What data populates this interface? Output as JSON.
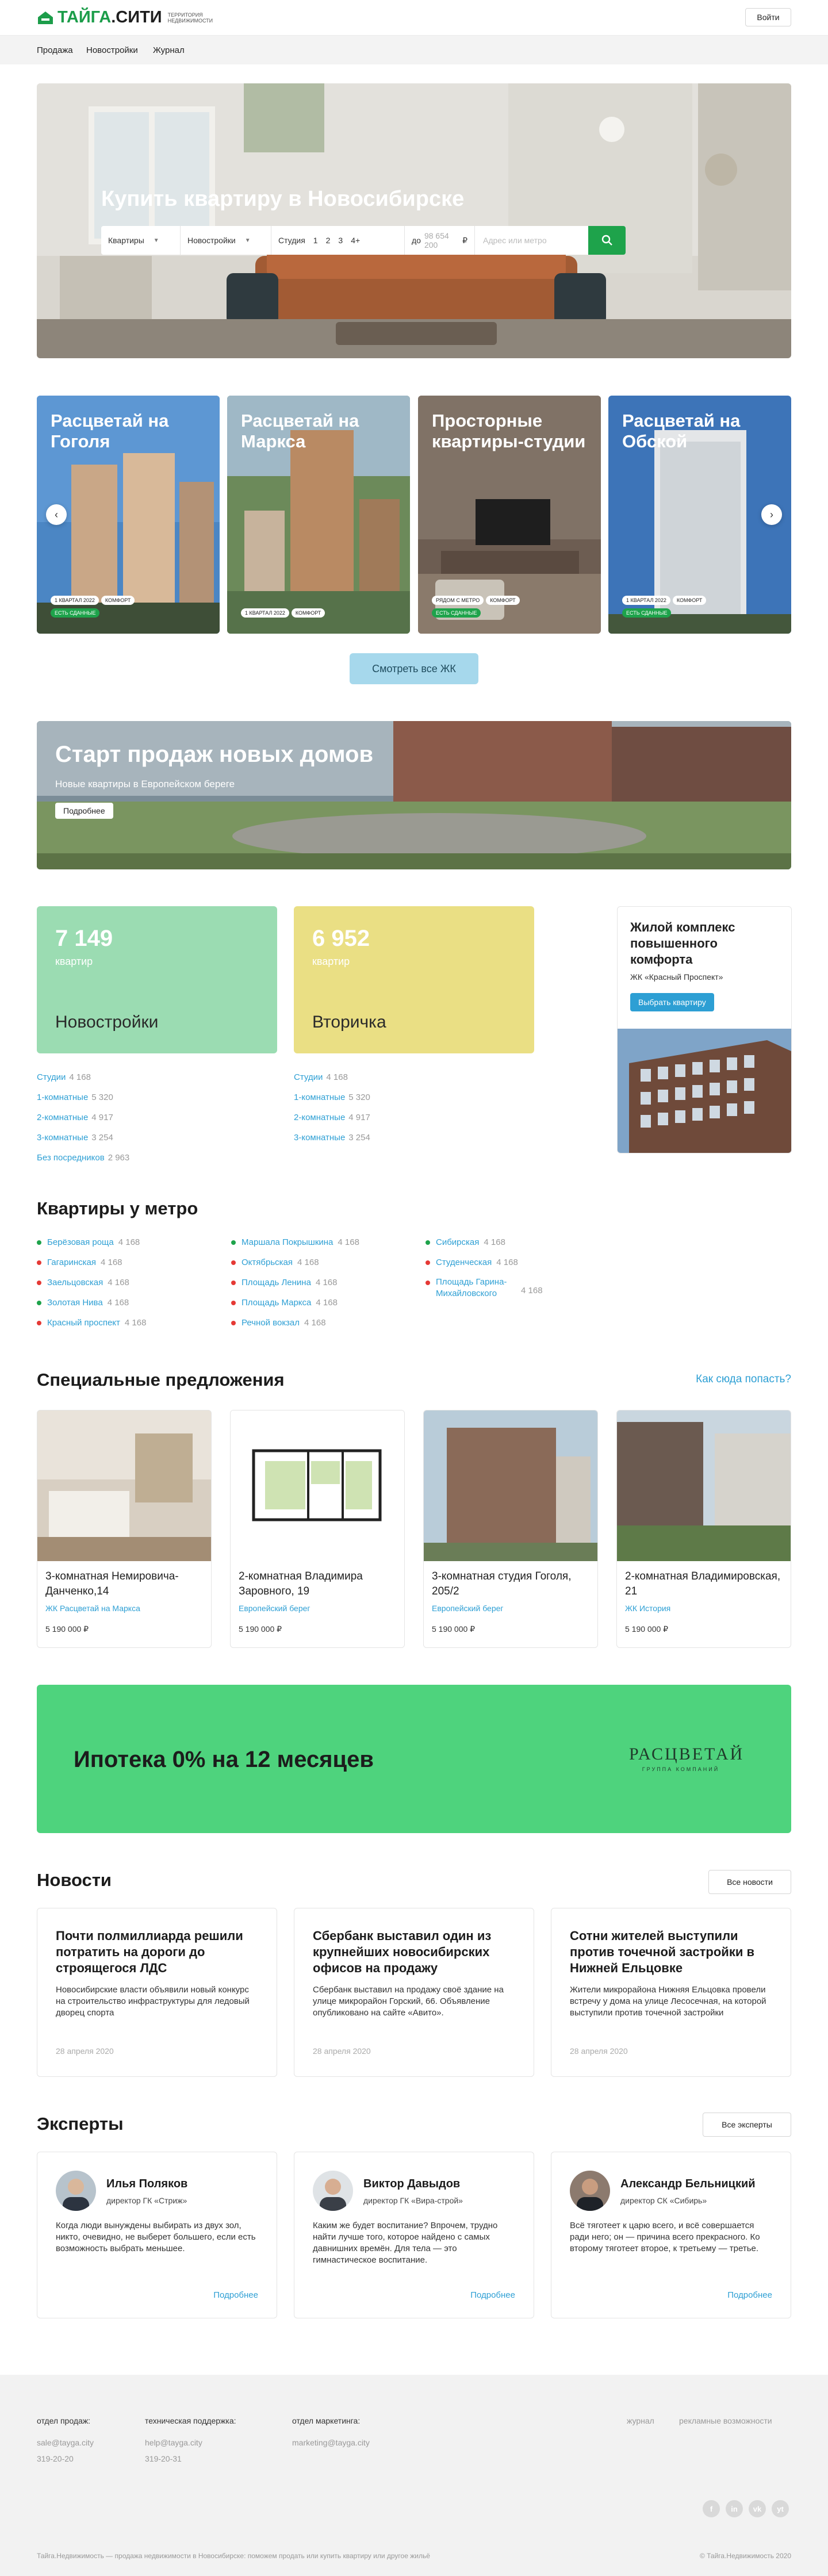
{
  "header": {
    "logo_main": "ТАЙГА",
    "logo_dot": ".СИТИ",
    "logo_sub_1": "Территория",
    "logo_sub_2": "недвижимости",
    "login": "Войти"
  },
  "nav": [
    "Продажа",
    "Новостройки",
    "Журнал"
  ],
  "hero": {
    "title": "Купить квартиру в Новосибирске",
    "search": {
      "type": "Квартиры",
      "market": "Новостройки",
      "rooms": [
        "Студия",
        "1",
        "2",
        "3",
        "4+"
      ],
      "price_prefix": "до",
      "price_value": "98 654 200",
      "price_unit": "₽",
      "address_placeholder": "Адрес или метро"
    }
  },
  "complexes": [
    {
      "title": "Расцветай на Гоголя",
      "tags": [
        "1 КВАРТАЛ 2022",
        "КОМФОРТ",
        "ЕСТЬ СДАННЫЕ"
      ]
    },
    {
      "title": "Расцветай на Маркса",
      "tags": [
        "1 КВАРТАЛ 2022",
        "КОМФОРТ"
      ]
    },
    {
      "title": "Просторные квартиры-студии",
      "tags": [
        "РЯДОМ С МЕТРО",
        "КОМФОРТ",
        "ЕСТЬ СДАННЫЕ"
      ]
    },
    {
      "title": "Расцветай на Обской",
      "tags": [
        "1 КВАРТАЛ 2022",
        "КОМФОРТ",
        "ЕСТЬ СДАННЫЕ"
      ]
    }
  ],
  "see_all": "Смотреть все ЖК",
  "banner": {
    "title": "Старт продаж новых домов",
    "subtitle": "Новые квартиры в Европейском береге",
    "button": "Подробнее"
  },
  "stats": [
    {
      "number": "7 149",
      "unit": "квартир",
      "title": "Новостройки",
      "color": "#9bdcb2",
      "links": [
        [
          "Студии",
          "4 168"
        ],
        [
          "1-комнатные",
          "5 320"
        ],
        [
          "2-комнатные",
          "4 917"
        ],
        [
          "3-комнатные",
          "3 254"
        ],
        [
          "Без посредников",
          "2 963"
        ]
      ]
    },
    {
      "number": "6 952",
      "unit": "квартир",
      "title": "Вторичка",
      "color": "#eadf84",
      "links": [
        [
          "Студии",
          "4 168"
        ],
        [
          "1-комнатные",
          "5 320"
        ],
        [
          "2-комнатные",
          "4 917"
        ],
        [
          "3-комнатные",
          "3 254"
        ]
      ]
    }
  ],
  "promo": {
    "title": "Жилой комплекс повышенного комфорта",
    "complex": "ЖК «Красный Проспект»",
    "button": "Выбрать квартиру"
  },
  "metro": {
    "title": "Квартиры у метро",
    "columns": [
      [
        [
          "Берёзовая роща",
          "4 168",
          "#1ea34b"
        ],
        [
          "Гагаринская",
          "4 168",
          "#e53935"
        ],
        [
          "Заельцовская",
          "4 168",
          "#e53935"
        ],
        [
          "Золотая Нива",
          "4 168",
          "#1ea34b"
        ],
        [
          "Красный проспект",
          "4 168",
          "#e53935"
        ]
      ],
      [
        [
          "Маршала Покрышкина",
          "4 168",
          "#1ea34b"
        ],
        [
          "Октябрьская",
          "4 168",
          "#e53935"
        ],
        [
          "Площадь Ленина",
          "4 168",
          "#e53935"
        ],
        [
          "Площадь Маркса",
          "4 168",
          "#e53935"
        ],
        [
          "Речной вокзал",
          "4 168",
          "#e53935"
        ]
      ],
      [
        [
          "Сибирская",
          "4 168",
          "#1ea34b"
        ],
        [
          "Студенческая",
          "4 168",
          "#e53935"
        ],
        [
          "Площадь Гарина-Михайловского",
          "4 168",
          "#e53935"
        ]
      ]
    ]
  },
  "offers": {
    "title": "Специальные предложения",
    "link": "Как сюда попасть?",
    "items": [
      {
        "title": "3-комнатная Немировича-Данченко,14",
        "complex": "ЖК Расцветай на Маркса",
        "price": "5 190 000 ₽"
      },
      {
        "title": "2-комнатная Владимира Заровного, 19",
        "complex": "Европейский берег",
        "price": "5 190 000 ₽"
      },
      {
        "title": "3-комнатная студия Гоголя, 205/2",
        "complex": "Европейский берег",
        "price": "5 190 000 ₽"
      },
      {
        "title": "2-комнатная Владимировская, 21",
        "complex": "ЖК История",
        "price": "5 190 000 ₽"
      }
    ]
  },
  "mortgage": {
    "text": "Ипотека 0% на 12 месяцев",
    "brand": "РАСЦВЕТАЙ",
    "brand_sub": "ГРУППА КОМПАНИЙ"
  },
  "news": {
    "title": "Новости",
    "all": "Все новости",
    "items": [
      {
        "title": "Почти полмиллиарда решили потратить на дороги до строящегося ЛДС",
        "text": "Новосибирские власти объявили новый конкурс на строительство инфраструктуры для ледовый дворец спорта",
        "date": "28 апреля 2020"
      },
      {
        "title": "Сбербанк выставил один из крупнейших новосибирских офисов на продажу",
        "text": "Сбербанк выставил на продажу своё здание на улице микрорайон Горский, 66. Объявление опубликовано на сайте «Авито».",
        "date": "28 апреля 2020"
      },
      {
        "title": "Сотни жителей выступили против точечной застройки в Нижней Ельцовке",
        "text": "Жители микрорайона Нижняя Ельцовка провели встречу у дома на улице Лесосечная, на которой выступили против точечной застройки",
        "date": "28 апреля 2020"
      }
    ]
  },
  "experts": {
    "title": "Эксперты",
    "all": "Все эксперты",
    "more": "Подробнее",
    "items": [
      {
        "name": "Илья Поляков",
        "position": "директор ГК «Стриж»",
        "text": "Когда люди вынуждены выбирать из двух зол, никто, очевидно, не выберет большего, если есть возможность выбрать меньшее."
      },
      {
        "name": "Виктор Давыдов",
        "position": "директор ГК «Вира-строй»",
        "text": "Каким же будет воспитание? Впрочем, трудно найти лучше того, которое найдено с самых давнишних времён. Для тела — это гимнастическое воспитание."
      },
      {
        "name": "Александр Бельницкий",
        "position": "директор СК «Сибирь»",
        "text": "Всё тяготеет к царю всего, и всё совершается ради него; он — причина всего прекрасного. Ко второму тяготеет второе, к третьему — третье."
      }
    ]
  },
  "footer": {
    "contacts": [
      {
        "label": "отдел продаж:",
        "email": "sale@tayga.city",
        "phone": "319-20-20"
      },
      {
        "label": "техническая поддержка:",
        "email": "help@tayga.city",
        "phone": "319-20-31"
      },
      {
        "label": "отдел маркетинга:",
        "email": "marketing@tayga.city",
        "phone": ""
      }
    ],
    "links": [
      "журнал",
      "рекламные возможности"
    ],
    "social": [
      "f",
      "in",
      "vk",
      "yt"
    ],
    "copy": "Тайга.Недвижимость — продажа недвижимости в Новосибирске: поможем продать или купить квартиру или другое жильё",
    "rights": "© Тайга.Недвижимость 2020"
  }
}
